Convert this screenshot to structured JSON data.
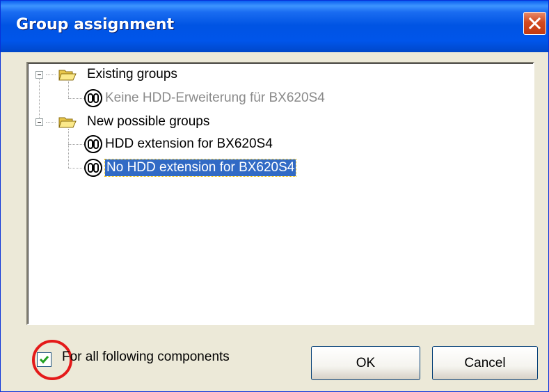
{
  "window": {
    "title": "Group assignment",
    "close_icon": "close-icon"
  },
  "tree": {
    "groups": [
      {
        "label": "Existing groups",
        "icon": "folder-open-icon",
        "items": [
          {
            "label": "Keine HDD-Erweiterung für BX620S4",
            "state": "disabled",
            "icon": "component-icon"
          }
        ]
      },
      {
        "label": "New possible groups",
        "icon": "folder-open-icon",
        "items": [
          {
            "label": "HDD extension for BX620S4",
            "state": "normal",
            "icon": "component-icon"
          },
          {
            "label": "No HDD extension for BX620S4",
            "state": "selected",
            "icon": "component-icon"
          }
        ]
      }
    ]
  },
  "options": {
    "all_components_label": "For all following components",
    "all_components_checked": true
  },
  "buttons": {
    "ok": "OK",
    "cancel": "Cancel"
  },
  "colors": {
    "titlebar": "#0054e3",
    "selection": "#316ac5",
    "highlight_circle": "#e41a1a"
  }
}
